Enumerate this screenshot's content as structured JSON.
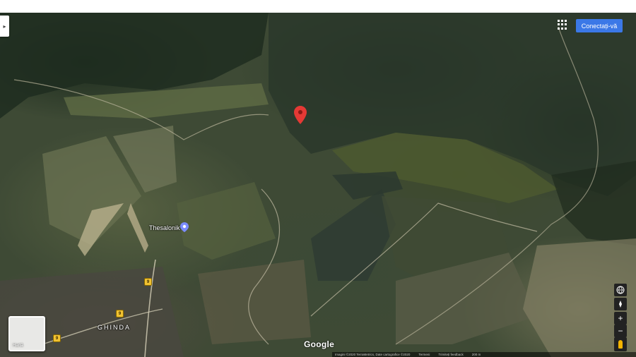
{
  "header": {
    "signin_label": "Conectați-vă"
  },
  "map": {
    "place_label": "Thesalonik",
    "town_label": "GHINDA",
    "road_shields": [
      "9",
      "9",
      "9"
    ],
    "google_logo": "Google",
    "minimap_label": "Hartă",
    "attribution": [
      "Imagini ©2020 TerraMetrics, Date cartografice ©2020",
      "Termeni",
      "Trimiteți feedback",
      "200 m"
    ],
    "controls": {
      "zoom_in": "+",
      "zoom_out": "−"
    },
    "pin_color": "#e53935"
  }
}
